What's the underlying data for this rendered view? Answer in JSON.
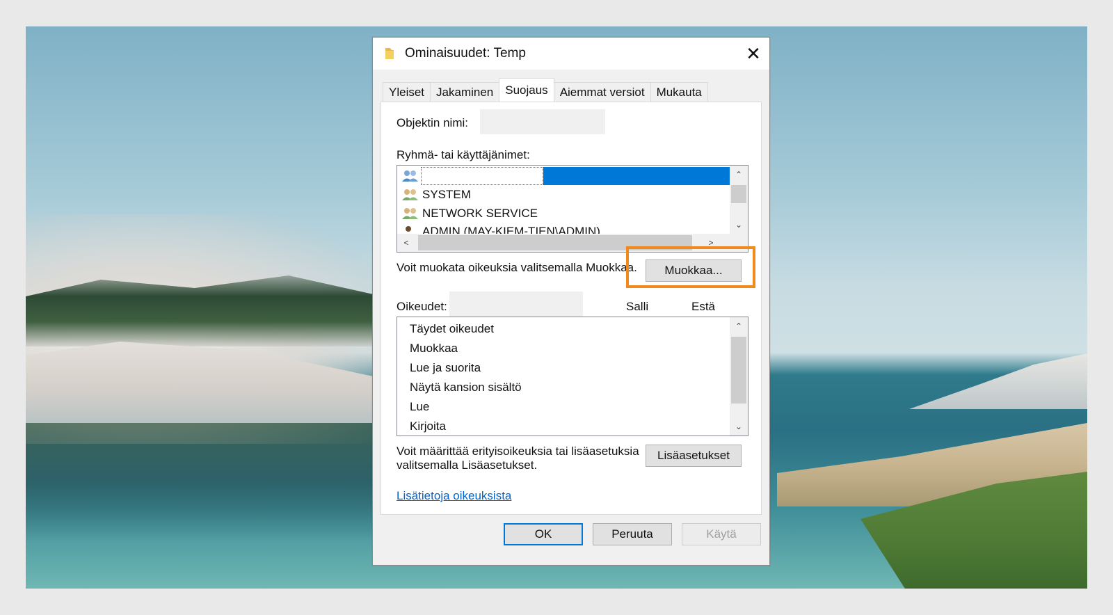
{
  "dialog": {
    "title": "Ominaisuudet: Temp",
    "close_glyph": "✕"
  },
  "tabs": [
    {
      "label": "Yleiset",
      "active": false
    },
    {
      "label": "Jakaminen",
      "active": false
    },
    {
      "label": "Suojaus",
      "active": true
    },
    {
      "label": "Aiemmat versiot",
      "active": false
    },
    {
      "label": "Mukauta",
      "active": false
    }
  ],
  "security": {
    "object_name_label": "Objektin nimi:",
    "groups_label": "Ryhmä- tai käyttäjänimet:",
    "users": [
      {
        "name": "",
        "icon": "group-icon",
        "selected": true
      },
      {
        "name": "SYSTEM",
        "icon": "group-icon",
        "selected": false
      },
      {
        "name": "NETWORK SERVICE",
        "icon": "group-icon",
        "selected": false
      },
      {
        "name": "ADMIN (MAY-KIEM-TIEN\\ADMIN)",
        "icon": "user-icon",
        "selected": false
      }
    ],
    "edit_hint": "Voit muokata oikeuksia valitsemalla Muokkaa.",
    "edit_button": "Muokkaa...",
    "permissions_label": "Oikeudet:",
    "allow_header": "Salli",
    "deny_header": "Estä",
    "permissions": [
      "Täydet oikeudet",
      "Muokkaa",
      "Lue ja suorita",
      "Näytä kansion sisältö",
      "Lue",
      "Kirjoita"
    ],
    "advanced_hint_line1": "Voit määrittää erityisoikeuksia tai lisäasetuksia",
    "advanced_hint_line2": "valitsemalla Lisäasetukset.",
    "advanced_button": "Lisäasetukset",
    "learn_more_link": "Lisätietoja oikeuksista"
  },
  "footer": {
    "ok": "OK",
    "cancel": "Peruuta",
    "apply": "Käytä"
  },
  "colors": {
    "selection": "#0078d7",
    "highlight_annotation": "#f08a1c",
    "link": "#0066cc"
  },
  "scroll_arrows": {
    "up": "⌃",
    "down": "⌄",
    "left": "<",
    "right": ">"
  }
}
